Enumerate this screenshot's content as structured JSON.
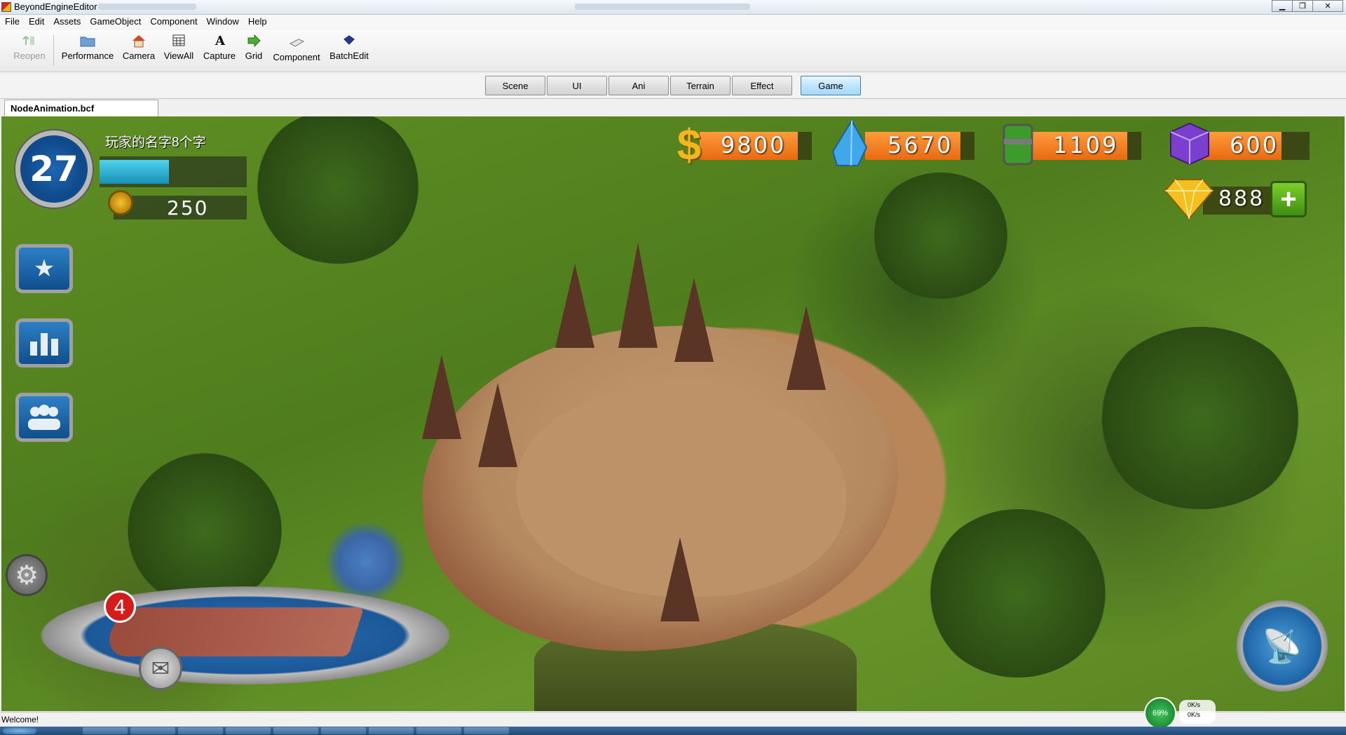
{
  "window": {
    "title": "BeyondEngineEditor",
    "controls": [
      "minimize",
      "restore",
      "close"
    ]
  },
  "menu": [
    "File",
    "Edit",
    "Assets",
    "GameObject",
    "Component",
    "Window",
    "Help"
  ],
  "toolbar": {
    "reopen": {
      "label": "Reopen",
      "icon": "reopen-icon",
      "enabled": false
    },
    "performance": {
      "label": "Performance",
      "icon": "folder-icon"
    },
    "camera": {
      "label": "Camera",
      "icon": "house-icon"
    },
    "viewall": {
      "label": "ViewAll",
      "icon": "grid-window-icon"
    },
    "capture": {
      "label": "Capture",
      "icon": "letter-a-icon"
    },
    "grid": {
      "label": "Grid",
      "icon": "green-arrow-icon"
    },
    "component": {
      "label": "Component",
      "icon": "card-icon"
    },
    "batchedit": {
      "label": "BatchEdit",
      "icon": "blue-gem-icon"
    }
  },
  "mode_tabs": {
    "scene": "Scene",
    "ui": "UI",
    "ani": "Ani",
    "terrain": "Terrain",
    "effect": "Effect",
    "game": "Game",
    "active": "Game"
  },
  "document_tab": "NodeAnimation.bcf",
  "game": {
    "player_level": "27",
    "player_name": "玩家的名字8个字",
    "xp_progress": 0.47,
    "medal_value": "250",
    "resources": {
      "gold": "9800",
      "crystal": "5670",
      "fuel": "1109",
      "cube": "600",
      "diamond": "888"
    },
    "notification_count": "4",
    "side_buttons": [
      "star-icon",
      "bar-chart-icon",
      "group-icon"
    ]
  },
  "status": {
    "message": "Welcome!",
    "net_percent": "69%",
    "up_rate": "0K/s",
    "down_rate": "0K/s"
  },
  "colors": {
    "resource_bar": "#e86a10",
    "level_badge": "#1d67b4",
    "xp_fill": "#1a8fb6",
    "active_tab": "#bee6fd"
  }
}
